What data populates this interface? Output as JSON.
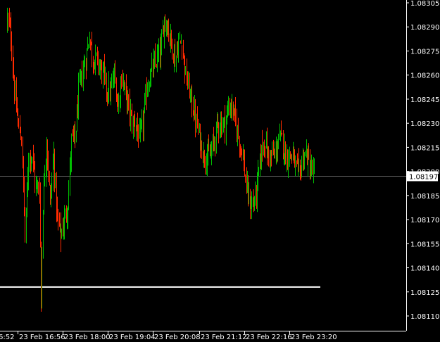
{
  "chart_data": {
    "type": "candlestick",
    "symbol_period_hidden": true,
    "y_axis": {
      "min": 1.081,
      "max": 1.08305,
      "tick_labels": [
        "1.08305",
        "1.08290",
        "1.08275",
        "1.08260",
        "1.08245",
        "1.08230",
        "1.08215",
        "1.08200",
        "1.08185",
        "1.08170",
        "1.08155",
        "1.08140",
        "1.08125",
        "1.08110"
      ],
      "tick_values": [
        1.08305,
        1.0829,
        1.08275,
        1.0826,
        1.08245,
        1.0823,
        1.08215,
        1.082,
        1.08185,
        1.0817,
        1.08155,
        1.0814,
        1.08125,
        1.0811
      ]
    },
    "x_axis": {
      "tick_labels": [
        "6:52",
        "23 Feb 16:56",
        "23 Feb 18:00",
        "23 Feb 19:04",
        "23 Feb 20:08",
        "23 Feb 21:12",
        "23 Feb 22:16",
        "23 Feb 23:20"
      ]
    },
    "current_price": {
      "label": "1.08197",
      "value": 1.08197
    },
    "horizontal_line": {
      "value": 1.08128
    },
    "colors": {
      "background": "#000000",
      "axis_text": "#ffffff",
      "axis_line": "#ffffff",
      "bull": "#00c000",
      "bear": "#ff2a00",
      "price_line": "#5a5a5a",
      "price_tag_bg": "#ffffff",
      "horizontal_line": "#ffffff"
    },
    "anchors": [
      [
        0,
        1.08295
      ],
      [
        4,
        1.08285
      ],
      [
        8,
        1.0825
      ],
      [
        12,
        1.0823
      ],
      [
        16,
        1.0822
      ],
      [
        20,
        1.0816
      ],
      [
        24,
        1.0821
      ],
      [
        28,
        1.0821
      ],
      [
        32,
        1.0819
      ],
      [
        36,
        1.0819
      ],
      [
        38,
        1.0812
      ],
      [
        40,
        1.0818
      ],
      [
        44,
        1.0822
      ],
      [
        48,
        1.0818
      ],
      [
        52,
        1.0821
      ],
      [
        56,
        1.0817
      ],
      [
        60,
        1.0816
      ],
      [
        64,
        1.0817
      ],
      [
        68,
        1.0818
      ],
      [
        72,
        1.0822
      ],
      [
        76,
        1.0822
      ],
      [
        80,
        1.0825
      ],
      [
        84,
        1.0826
      ],
      [
        88,
        1.0827
      ],
      [
        92,
        1.08285
      ],
      [
        96,
        1.0827
      ],
      [
        100,
        1.0827
      ],
      [
        104,
        1.08265
      ],
      [
        108,
        1.0826
      ],
      [
        112,
        1.0825
      ],
      [
        116,
        1.0825
      ],
      [
        120,
        1.0826
      ],
      [
        124,
        1.0824
      ],
      [
        128,
        1.0826
      ],
      [
        132,
        1.0825
      ],
      [
        136,
        1.0824
      ],
      [
        140,
        1.0823
      ],
      [
        144,
        1.0823
      ],
      [
        148,
        1.0822
      ],
      [
        152,
        1.0823
      ],
      [
        156,
        1.0825
      ],
      [
        160,
        1.0826
      ],
      [
        164,
        1.08265
      ],
      [
        168,
        1.0827
      ],
      [
        172,
        1.08275
      ],
      [
        176,
        1.08295
      ],
      [
        180,
        1.0829
      ],
      [
        184,
        1.0828
      ],
      [
        188,
        1.0827
      ],
      [
        192,
        1.0828
      ],
      [
        196,
        1.0828
      ],
      [
        200,
        1.0826
      ],
      [
        204,
        1.0825
      ],
      [
        208,
        1.0824
      ],
      [
        212,
        1.0823
      ],
      [
        216,
        1.0822
      ],
      [
        220,
        1.0821
      ],
      [
        224,
        1.0821
      ],
      [
        228,
        1.0821
      ],
      [
        232,
        1.0822
      ],
      [
        236,
        1.0823
      ],
      [
        240,
        1.0823
      ],
      [
        244,
        1.0823
      ],
      [
        248,
        1.0824
      ],
      [
        252,
        1.0824
      ],
      [
        256,
        1.0823
      ],
      [
        260,
        1.0822
      ],
      [
        264,
        1.0821
      ],
      [
        268,
        1.0819
      ],
      [
        272,
        1.0818
      ],
      [
        276,
        1.0818
      ],
      [
        280,
        1.0819
      ],
      [
        284,
        1.0821
      ],
      [
        288,
        1.0822
      ],
      [
        292,
        1.0821
      ],
      [
        296,
        1.0821
      ],
      [
        300,
        1.0821
      ],
      [
        304,
        1.0822
      ],
      [
        308,
        1.0822
      ],
      [
        312,
        1.0821
      ],
      [
        316,
        1.0821
      ],
      [
        320,
        1.0821
      ],
      [
        324,
        1.082
      ],
      [
        328,
        1.082
      ],
      [
        332,
        1.0821
      ],
      [
        336,
        1.0821
      ],
      [
        340,
        1.082
      ],
      [
        344,
        1.082
      ]
    ]
  }
}
